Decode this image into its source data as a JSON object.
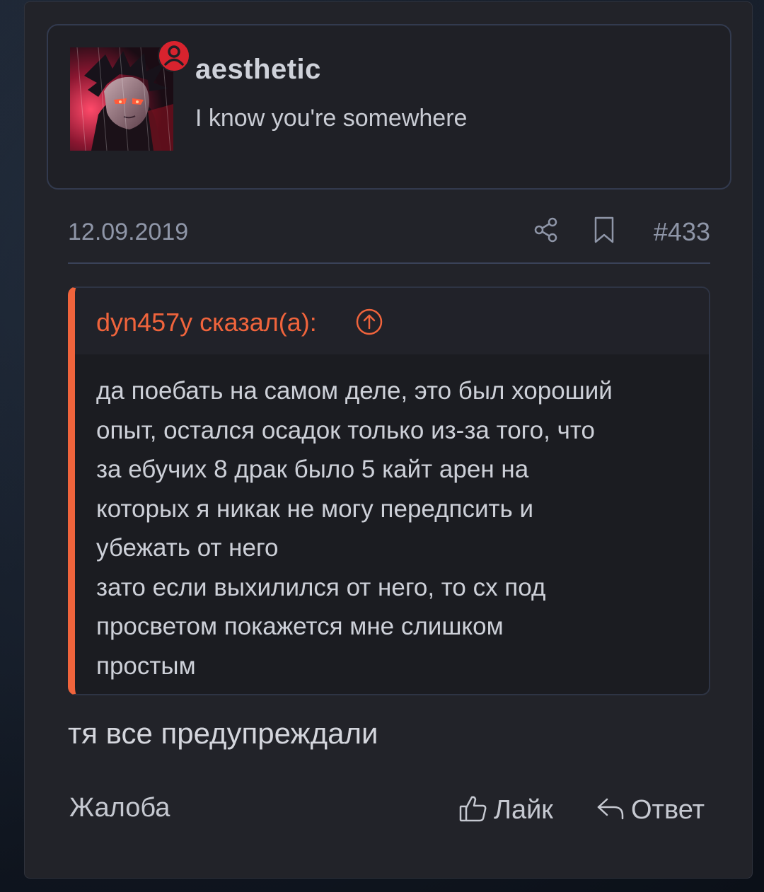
{
  "author": {
    "username": "aesthetic",
    "status_text": "I know you're somewhere",
    "avatar_icon": "anime-avatar",
    "online_indicator_icon": "user-status-icon",
    "indicator_color": "#d8232e"
  },
  "meta": {
    "date": "12.09.2019",
    "post_number": "#433",
    "share_icon": "share-icon",
    "bookmark_icon": "bookmark-icon"
  },
  "quote": {
    "author_line": "dyn457y сказал(а):",
    "jump_icon": "arrow-up-circle-icon",
    "text": "да поебать на самом деле, это был хороший\nопыт, остался осадок только из-за того, что\nза ебучих 8 драк было 5 кайт арен на\nкоторых я никак не могу передпсить и\nубежать от него\nзато если выхилился от него, то сх под\nпросветом покажется мне слишком\nпростым",
    "accent_color": "#f0643c"
  },
  "message": {
    "text": "тя все предупреждали"
  },
  "actions": {
    "report_label": "Жалоба",
    "like_label": "Лайк",
    "reply_label": "Ответ",
    "like_icon": "thumbs-up-icon",
    "reply_icon": "reply-arrow-icon"
  }
}
